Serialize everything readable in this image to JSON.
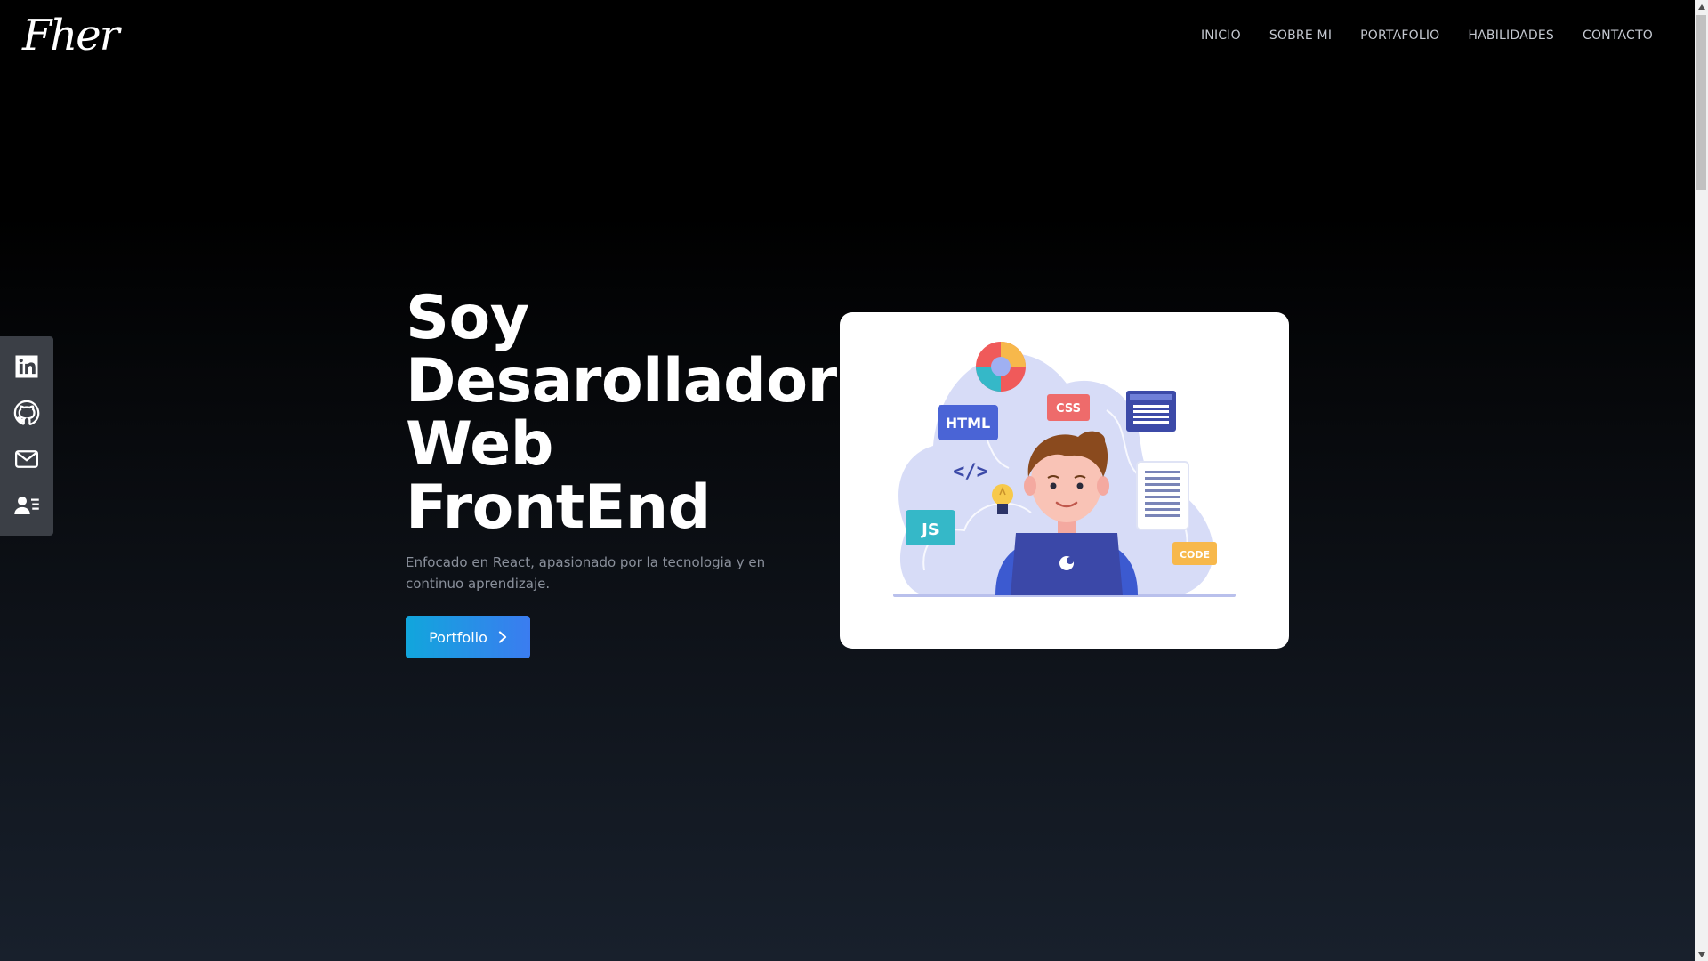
{
  "header": {
    "logo_text": "Fher",
    "nav": [
      "INICIO",
      "SOBRE MI",
      "PORTAFOLIO",
      "HABILIDADES",
      "CONTACTO"
    ]
  },
  "social": {
    "icons": [
      "linkedin-icon",
      "github-icon",
      "mail-icon",
      "resume-icon"
    ]
  },
  "hero": {
    "title_lines": [
      "Soy",
      "Desarollador",
      "Web",
      "FrontEnd"
    ],
    "subtitle": "Enfocado en React, apasionado por la tecnologia y en continuo aprendizaje.",
    "cta_label": "Portfolio"
  },
  "illustration": {
    "labels": {
      "html": "HTML",
      "css": "CSS",
      "js": "JS",
      "code": "CODE",
      "tag": "</>"
    }
  },
  "colors": {
    "accent_start": "#11a6dc",
    "accent_end": "#3b7cf0",
    "nav_text": "#c4c8d0",
    "subtitle_text": "#8a909b",
    "sidebar_bg": "#3b3f46"
  }
}
